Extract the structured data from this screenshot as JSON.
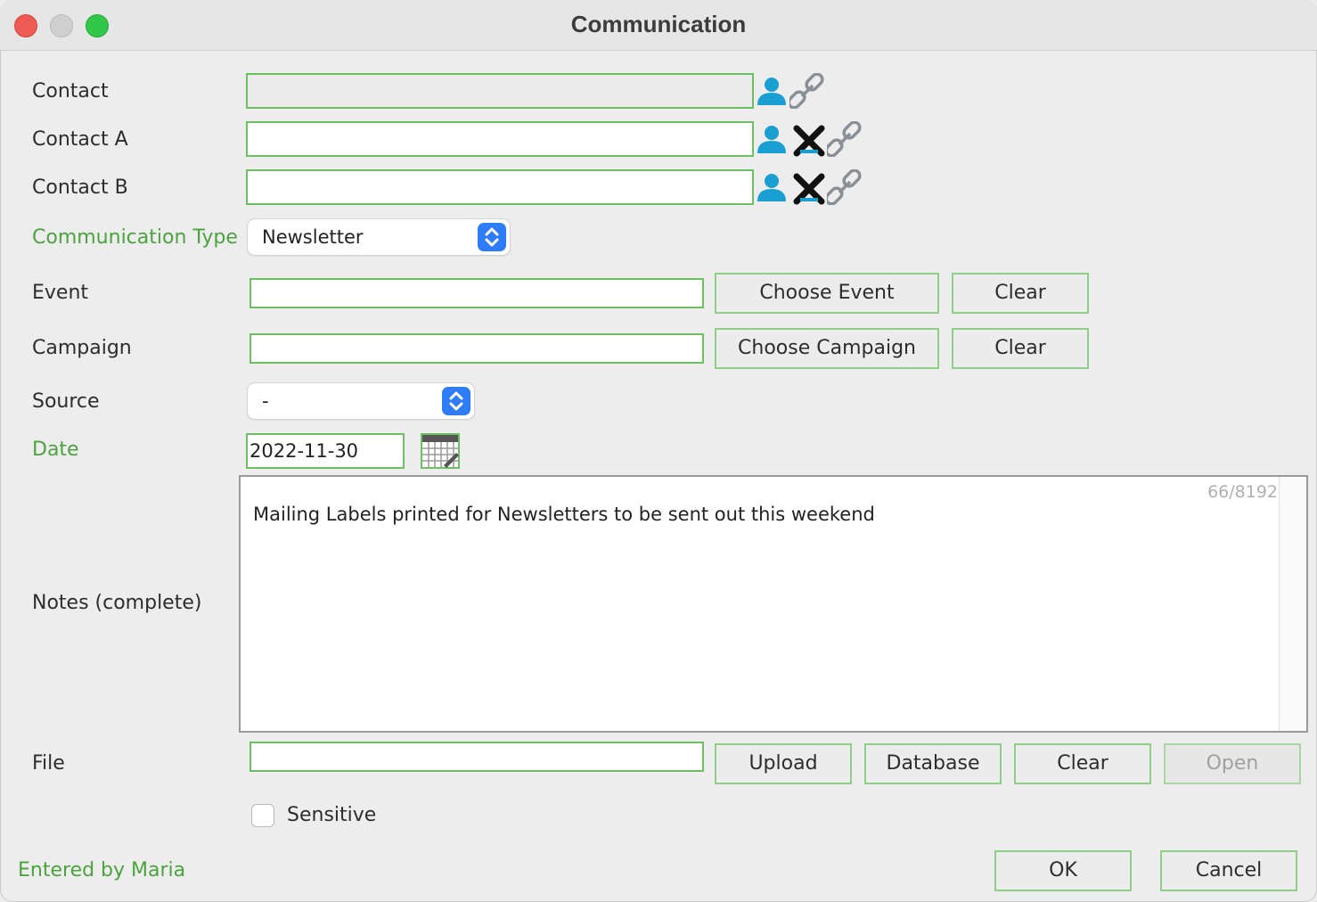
{
  "window": {
    "title": "Communication"
  },
  "form": {
    "contact_label": "Contact",
    "contact_a_label": "Contact A",
    "contact_b_label": "Contact B",
    "communication_type_label": "Communication Type",
    "communication_type_value": "Newsletter",
    "event_label": "Event",
    "event_value": "",
    "choose_event_label": "Choose Event",
    "clear_label": "Clear",
    "campaign_label": "Campaign",
    "campaign_value": "",
    "choose_campaign_label": "Choose Campaign",
    "source_label": "Source",
    "source_value": "-",
    "date_label": "Date",
    "date_value": "2022-11-30",
    "notes_label": "Notes (complete)",
    "notes_value": "Mailing Labels printed for Newsletters to be sent out this weekend",
    "notes_counter": "66/8192",
    "file_label": "File",
    "upload_label": "Upload",
    "database_label": "Database",
    "open_label": "Open",
    "sensitive_label": "Sensitive"
  },
  "footer": {
    "entered_by": "Entered by Maria",
    "ok_label": "OK",
    "cancel_label": "Cancel"
  },
  "colors": {
    "accent_green": "#4ba33e",
    "field_border": "#6cbf63",
    "select_arrow_blue": "#2e7cf6",
    "person_icon_blue": "#1a9fd3"
  },
  "icons": [
    "person-icon",
    "link-icon",
    "remove-x-icon",
    "calendar-icon",
    "chevron-updown-icon"
  ]
}
